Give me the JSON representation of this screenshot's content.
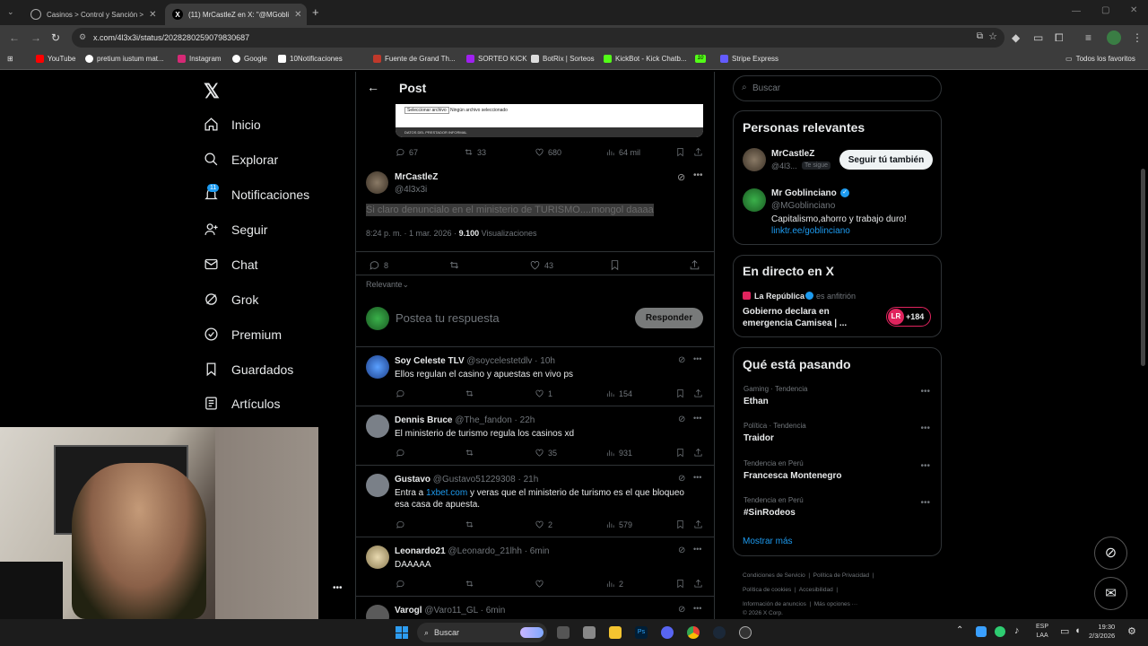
{
  "browser": {
    "tabs": [
      {
        "title": "Casinos > Control y Sanción >",
        "active": false
      },
      {
        "title": "(11) MrCastleZ en X: \"@MGobli",
        "active": true
      }
    ],
    "url": "x.com/4l3x3i/status/2028280259079830687",
    "bookmarks": [
      "YouTube",
      "pretium iustum mat...",
      "Instagram",
      "Google",
      "10Notificaciones",
      "Fuente de Grand Th...",
      "SORTEO KICK",
      "BotRix | Sorteos",
      "KickBot - Kick Chatb...",
      "Stripe Express"
    ],
    "bookmark_badge": "10",
    "all_favorites": "Todos los favoritos"
  },
  "nav": {
    "items": [
      "Inicio",
      "Explorar",
      "Notificaciones",
      "Seguir",
      "Chat",
      "Grok",
      "Premium",
      "Guardados",
      "Artículos"
    ],
    "notif_badge": "11"
  },
  "post": {
    "header": "Post",
    "prev_tweet": {
      "replies": "67",
      "reposts": "33",
      "likes": "680",
      "views": "64 mil",
      "image_button": "Seleccionar archivo",
      "image_text": "Ningún archivo seleccionado",
      "image_footer": "DATOS DEL PRESTADOR INFORMAL"
    },
    "author": "MrCastleZ",
    "handle": "@4l3x3i",
    "text": "Si claro denuncialo en el ministerio de TURISMO....mongol daaaa",
    "time": "8:24 p. m. · 1 mar. 2026 ·",
    "views_count": "9.100",
    "views_label": "Visualizaciones",
    "replies": "8",
    "likes": "43",
    "sort": "Relevante",
    "compose_placeholder": "Postea tu respuesta",
    "reply_button": "Responder"
  },
  "replies": [
    {
      "name": "Soy Celeste TLV",
      "handle": "@soycelestetdlv · 10h",
      "text": "Ellos regulan el casino y apuestas en vivo ps",
      "likes": "1",
      "views": "154"
    },
    {
      "name": "Dennis Bruce",
      "handle": "@The_fandon · 22h",
      "text": "El ministerio de turismo regula los casinos xd",
      "likes": "35",
      "views": "931"
    },
    {
      "name": "Gustavo",
      "handle": "@Gustavo51229308 · 21h",
      "text_pre": "Entra a ",
      "link": "1xbet.com",
      "text_post": " y veras que el ministerio de turismo es el que bloqueo esa casa de apuesta.",
      "likes": "2",
      "views": "579"
    },
    {
      "name": "Leonardo21",
      "handle": "@Leonardo_21lhh · 6min",
      "text": "DAAAAA",
      "likes": "",
      "views": "2"
    },
    {
      "name": "Varogl",
      "handle": "@Varo11_GL · 6min",
      "text": "",
      "likes": "",
      "views": ""
    }
  ],
  "sidebar": {
    "search_placeholder": "Buscar",
    "relevant_title": "Personas relevantes",
    "p1_name": "MrCastleZ",
    "p1_handle": "@4l3...",
    "p1_badge": "Te sigue",
    "p1_button": "Seguir tú también",
    "p2_name": "Mr Goblinciano",
    "p2_handle": "@MGoblinciano",
    "p2_bio": "Capitalismo,ahorro y trabajo duro!",
    "p2_link": "linktr.ee/goblinciano",
    "live_title": "En directo en X",
    "live_host": "La República",
    "live_host_note": "es anfitrión",
    "live_text1": "Gobierno declara en",
    "live_text2": "emergencia Camisea | ...",
    "live_count": "+184",
    "live_logo": "LR",
    "trends_title": "Qué está pasando",
    "trends": [
      {
        "cat": "Gaming · Tendencia",
        "name": "Ethan"
      },
      {
        "cat": "Política · Tendencia",
        "name": "Traidor"
      },
      {
        "cat": "Tendencia en Perú",
        "name": "Francesca Montenegro"
      },
      {
        "cat": "Tendencia en Perú",
        "name": "#SinRodeos"
      }
    ],
    "show_more": "Mostrar más",
    "footer": [
      "Condiciones de Servicio",
      "Política de Privacidad",
      "Política de cookies",
      "Accesibilidad",
      "Información de anuncios",
      "Más opciones ···",
      "© 2026 X Corp."
    ]
  },
  "taskbar": {
    "search": "Buscar",
    "lang1": "ESP",
    "lang2": "LAA",
    "time": "19:30",
    "date": "2/3/2026"
  },
  "colors": {
    "accent": "#1d9bf0",
    "bg": "#000000",
    "border": "#2f3336"
  }
}
